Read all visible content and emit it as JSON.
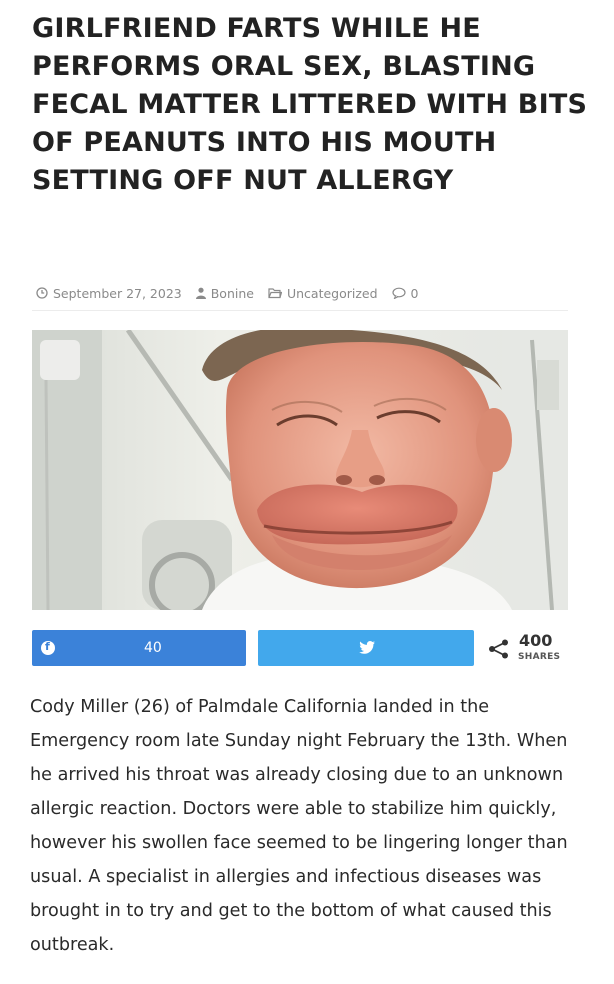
{
  "article": {
    "title": "GIRLFRIEND FARTS WHILE HE PERFORMS ORAL SEX, BLASTING FECAL MATTER LITTERED WITH BITS OF PEANUTS INTO HIS MOUTH SETTING OFF NUT ALLERGY",
    "meta": {
      "date": "September 27, 2023",
      "author": "Bonine",
      "category": "Uncategorized",
      "comments": "0"
    },
    "body": "Cody Miller (26) of Palmdale California landed in the Emergency room late Sunday night February the 13th. When he arrived his throat was already closing due to an unknown allergic reaction. Doctors were able to stabilize him quickly, however his swollen face seemed to be lingering longer than usual. A specialist in allergies and infectious diseases was brought in to try and get to the bottom of what caused this outbreak."
  },
  "share": {
    "facebook_count": "40",
    "total_count": "400",
    "total_label": "SHARES"
  },
  "colors": {
    "facebook": "#3b82d9",
    "twitter": "#42a8ec",
    "meta_text": "#8a8a8a"
  },
  "icons": {
    "date": "clock-icon",
    "author": "user-icon",
    "category": "folder-icon",
    "comments": "comment-icon",
    "facebook": "facebook-icon",
    "twitter": "twitter-icon",
    "share": "share-icon"
  }
}
